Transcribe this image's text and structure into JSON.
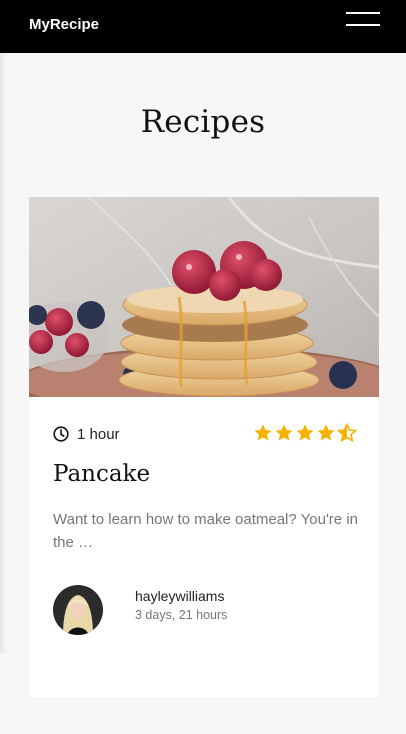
{
  "header": {
    "brand": "MyRecipe",
    "menu_icon": "hamburger-menu-icon"
  },
  "page": {
    "title": "Recipes"
  },
  "recipe_card": {
    "image_alt": "pancakes-with-raspberries-photo",
    "time_icon": "clock-icon",
    "time": "1 hour",
    "rating": {
      "value": 4.5,
      "max": 5,
      "color": "#f5b301"
    },
    "title": "Pancake",
    "description": "Want to learn how to make oatmeal? You're in the …",
    "author": {
      "username": "hayleywilliams",
      "posted_ago": "3 days, 21 hours"
    }
  }
}
